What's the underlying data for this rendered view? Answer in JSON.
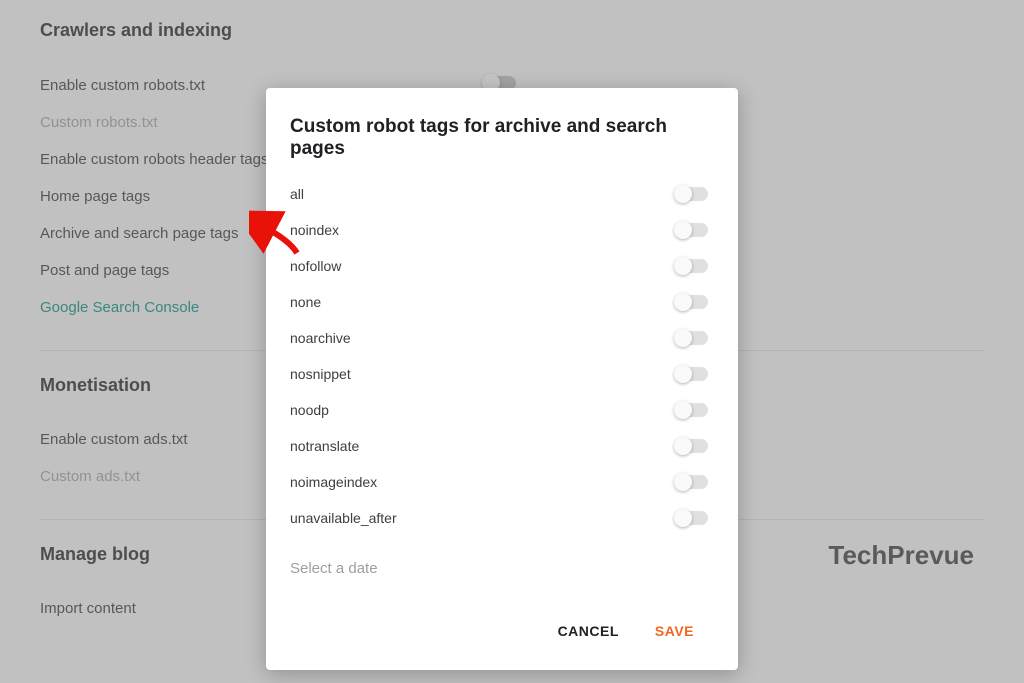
{
  "sections": {
    "crawlers": {
      "title": "Crawlers and indexing",
      "items": {
        "enable_robots_txt": "Enable custom robots.txt",
        "custom_robots_txt": "Custom robots.txt",
        "enable_header_tags": "Enable custom robots header tags",
        "home_page_tags": "Home page tags",
        "archive_search_tags": "Archive and search page tags",
        "post_page_tags": "Post and page tags",
        "google_search_console": "Google Search Console"
      }
    },
    "monetisation": {
      "title": "Monetisation",
      "items": {
        "enable_ads_txt": "Enable custom ads.txt",
        "custom_ads_txt": "Custom ads.txt"
      }
    },
    "manage_blog": {
      "title": "Manage blog",
      "items": {
        "import_content": "Import content"
      }
    }
  },
  "watermark": "TechPrevue",
  "dialog": {
    "title": "Custom robot tags for archive and search pages",
    "tags": [
      "all",
      "noindex",
      "nofollow",
      "none",
      "noarchive",
      "nosnippet",
      "noodp",
      "notranslate",
      "noimageindex",
      "unavailable_after"
    ],
    "select_date": "Select a date",
    "cancel": "CANCEL",
    "save": "SAVE"
  }
}
